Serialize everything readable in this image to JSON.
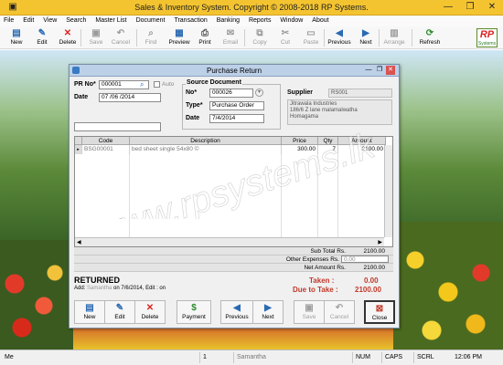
{
  "window": {
    "title": "Sales & Inventory System. Copyright © 2008-2018 RP Systems.",
    "minimize_icon": "minimize-icon",
    "maximize_icon": "restore-icon",
    "close_icon": "close-icon"
  },
  "menu": [
    "File",
    "Edit",
    "View",
    "Search",
    "Master List",
    "Document",
    "Transaction",
    "Banking",
    "Reports",
    "Window",
    "About"
  ],
  "toolbar": [
    {
      "label": "New",
      "icon": "new-doc-icon",
      "enabled": true
    },
    {
      "label": "Edit",
      "icon": "edit-icon",
      "enabled": true
    },
    {
      "label": "Delete",
      "icon": "delete-icon",
      "enabled": true
    },
    {
      "label": "Save",
      "icon": "save-icon",
      "enabled": false
    },
    {
      "label": "Cancel",
      "icon": "cancel-icon",
      "enabled": false
    },
    {
      "label": "Find",
      "icon": "find-icon",
      "enabled": false
    },
    {
      "label": "Preview",
      "icon": "preview-icon",
      "enabled": true
    },
    {
      "label": "Print",
      "icon": "print-icon",
      "enabled": true
    },
    {
      "label": "Email",
      "icon": "email-icon",
      "enabled": false
    },
    {
      "label": "Copy",
      "icon": "copy-icon",
      "enabled": false
    },
    {
      "label": "Cut",
      "icon": "cut-icon",
      "enabled": false
    },
    {
      "label": "Paste",
      "icon": "paste-icon",
      "enabled": false
    },
    {
      "label": "Previous",
      "icon": "previous-icon",
      "enabled": true
    },
    {
      "label": "Next",
      "icon": "next-icon",
      "enabled": true
    },
    {
      "label": "Arrange",
      "icon": "arrange-icon",
      "enabled": false
    },
    {
      "label": "Refresh",
      "icon": "refresh-icon",
      "enabled": true
    }
  ],
  "logo": {
    "text": "RP",
    "sub": "Systems"
  },
  "dialog": {
    "title": "Purchase Return",
    "pr_no_label": "PR No*",
    "pr_no": "000001",
    "auto_label": "Auto",
    "date_label": "Date",
    "date": "07 /06 /2014",
    "source_title": "Source Document",
    "src_no_label": "No*",
    "src_no": "000026",
    "type_label": "Type*",
    "type": "Purchase Order",
    "src_date_label": "Date",
    "src_date": "7/4/2014",
    "supplier_label": "Supplier",
    "supplier_code": "RS001",
    "supplier_addr1": "Jitrawala Industries",
    "supplier_addr2": "186/6 Z lane malamalwatha",
    "supplier_addr3": "Homagama"
  },
  "grid": {
    "headers": [
      "Code",
      "Description",
      "Price",
      "Qty",
      "Amount"
    ],
    "rows": [
      {
        "code": "BSG00001",
        "description": "bed sheet single 54x80 ©",
        "price": "300.00",
        "qty": "7",
        "amount": "2100.00"
      }
    ]
  },
  "totals": {
    "subtotal_label": "Sub Total Rs.",
    "subtotal": "2100.00",
    "other_label": "Other Expenses Rs.",
    "other": "0.00",
    "net_label": "Net Amount Rs.",
    "net": "2100.00"
  },
  "status": {
    "state": "RETURNED",
    "audit_prefix": "Add:",
    "audit_user": "Samantha",
    "audit_text": "on 7/6/2014, Edit : on",
    "taken_label": "Taken :",
    "taken": "0.00",
    "due_label": "Due to Take :",
    "due": "2100.00"
  },
  "dialog_buttons": [
    {
      "label": "New",
      "icon": "new-doc-icon",
      "enabled": true
    },
    {
      "label": "Edit",
      "icon": "edit-icon",
      "enabled": true
    },
    {
      "label": "Delete",
      "icon": "delete-icon",
      "enabled": true
    },
    {
      "label": "Payment",
      "icon": "payment-icon",
      "enabled": true
    },
    {
      "label": "Previous",
      "icon": "previous-icon",
      "enabled": true
    },
    {
      "label": "Next",
      "icon": "next-icon",
      "enabled": true
    },
    {
      "label": "Save",
      "icon": "save-icon",
      "enabled": false
    },
    {
      "label": "Cancel",
      "icon": "cancel-icon",
      "enabled": false
    },
    {
      "label": "Close",
      "icon": "close-door-icon",
      "enabled": true
    }
  ],
  "statusbar": {
    "user": "Me",
    "count": "1",
    "company": "Samantha",
    "num": "NUM",
    "caps": "CAPS",
    "scrl": "SCRL",
    "time": "12:06 PM"
  },
  "watermark": "www.rpsystems.lk",
  "colors": {
    "titlebar": "#f4c430",
    "dialog_title": "#bcd0e8",
    "due_red": "#c0392b"
  }
}
